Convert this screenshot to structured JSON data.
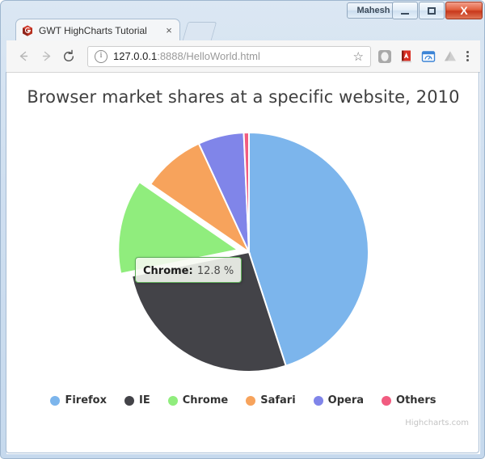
{
  "window": {
    "user_label": "Mahesh",
    "minimize_label": "Minimize",
    "maximize_label": "Maximize",
    "close_label": "X"
  },
  "tab": {
    "title": "GWT HighCharts Tutorial",
    "close_glyph": "×",
    "favicon_name": "gwt-favicon"
  },
  "toolbar": {
    "back_glyph": "←",
    "forward_glyph": "→",
    "reload_glyph": "⟳",
    "url_host": "127.0.0.1",
    "url_path": ":8888/HelloWorld.html",
    "url_full": "127.0.0.1:8888/HelloWorld.html",
    "star_glyph": "☆",
    "extensions": [
      {
        "name": "shield-extension-icon"
      },
      {
        "name": "red-book-extension-icon"
      },
      {
        "name": "blue-window-extension-icon"
      },
      {
        "name": "google-drive-icon"
      }
    ]
  },
  "tooltip": {
    "name": "Chrome",
    "separator": ":",
    "value": "12.8 %",
    "border_color": "#5FAE5A"
  },
  "credits": "Highcharts.com",
  "chart_data": {
    "type": "pie",
    "title": "Browser market shares at a specific website, 2010",
    "xlabel": "",
    "ylabel": "",
    "legend_position": "bottom",
    "value_suffix": "%",
    "categories": [
      "Firefox",
      "IE",
      "Chrome",
      "Safari",
      "Opera",
      "Others"
    ],
    "values": [
      45.0,
      26.8,
      12.8,
      8.5,
      6.2,
      0.7
    ],
    "colors": [
      "#7CB5EC",
      "#434348",
      "#90ED7D",
      "#F7A35C",
      "#8085E9",
      "#F15C80"
    ],
    "sliced": [
      "Chrome"
    ],
    "slices": [
      {
        "label": "Firefox",
        "value": 45.0,
        "color": "#7CB5EC",
        "start_angle": 0.0,
        "end_angle": 162.0
      },
      {
        "label": "IE",
        "value": 26.8,
        "color": "#434348",
        "start_angle": 162.0,
        "end_angle": 258.5
      },
      {
        "label": "Chrome",
        "value": 12.8,
        "color": "#90ED7D",
        "start_angle": 258.5,
        "end_angle": 304.6,
        "sliced": true
      },
      {
        "label": "Safari",
        "value": 8.5,
        "color": "#F7A35C",
        "start_angle": 304.6,
        "end_angle": 335.2
      },
      {
        "label": "Opera",
        "value": 6.2,
        "color": "#8085E9",
        "start_angle": 335.2,
        "end_angle": 357.5
      },
      {
        "label": "Others",
        "value": 0.7,
        "color": "#F15C80",
        "start_angle": 357.5,
        "end_angle": 360.0
      }
    ]
  }
}
